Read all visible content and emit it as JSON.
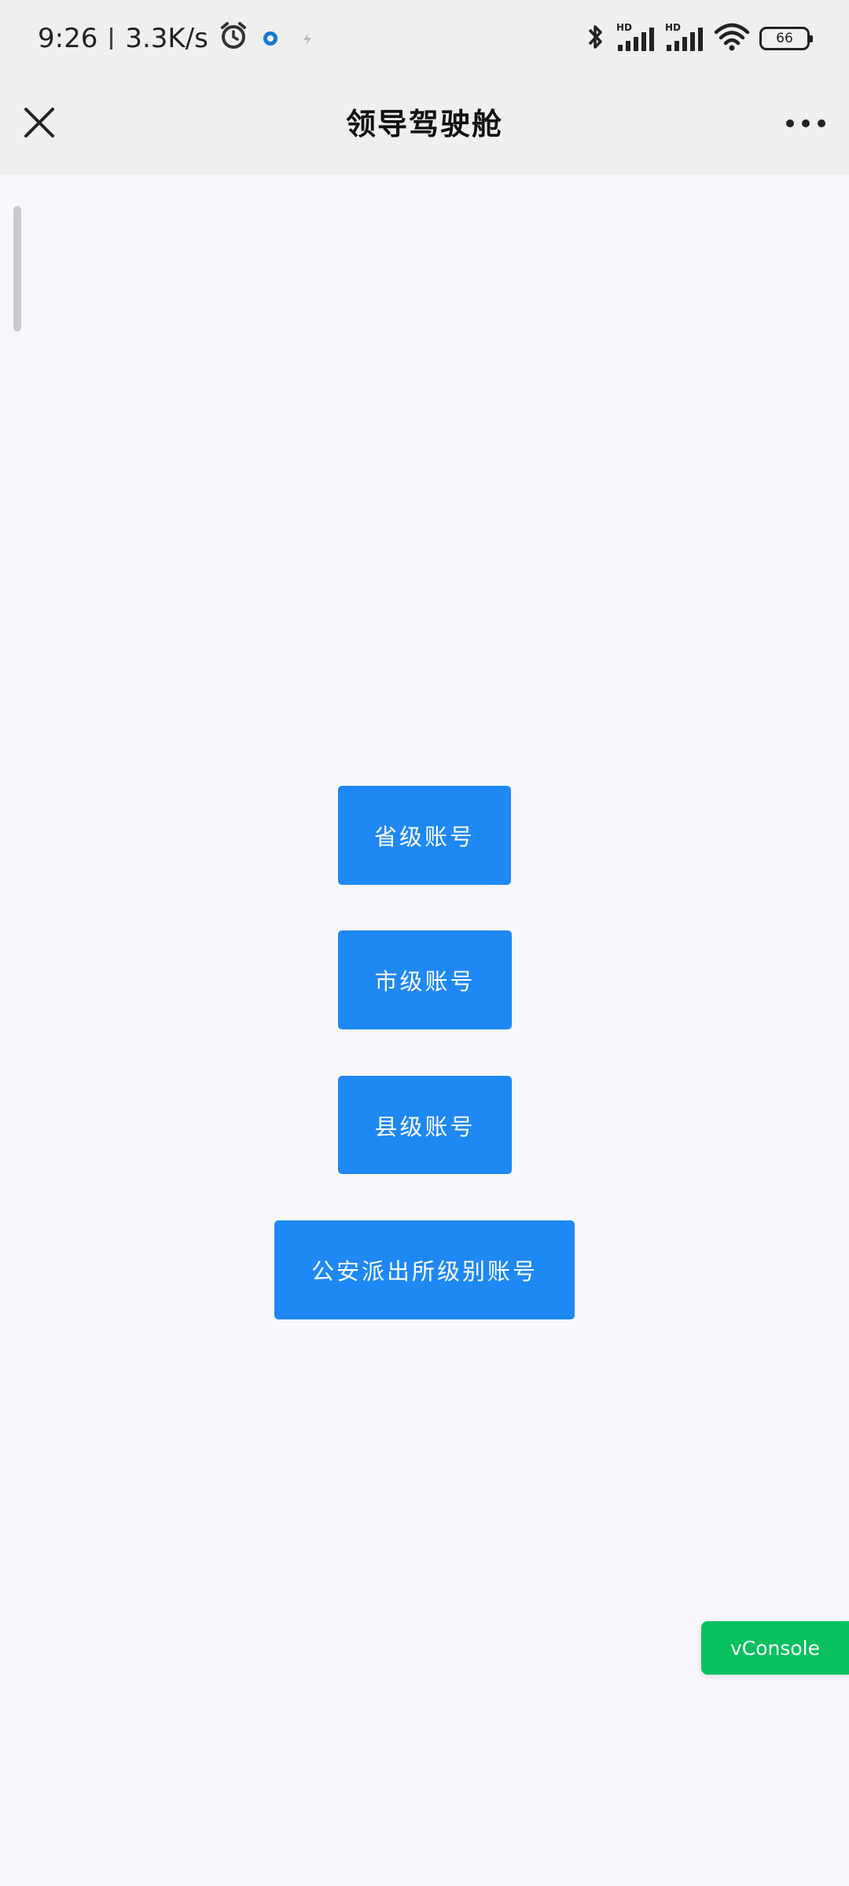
{
  "status_bar": {
    "time": "9:26",
    "net_speed": "3.3K/s",
    "icons": [
      "alarm-icon",
      "app-notification-icon",
      "bolt-icon",
      "bluetooth-icon",
      "hd-signal-icon",
      "hd-signal-icon",
      "wifi-icon"
    ],
    "signal1_label": "HD",
    "signal2_label": "HD",
    "battery_level": "66"
  },
  "header": {
    "title": "领导驾驶舱",
    "close_icon": "close-icon",
    "more_icon": "more-dots-icon"
  },
  "main": {
    "buttons": [
      {
        "label": "省级账号"
      },
      {
        "label": "市级账号"
      },
      {
        "label": "县级账号"
      },
      {
        "label": "公安派出所级别账号"
      }
    ]
  },
  "vconsole": {
    "label": "vConsole",
    "color": "#07c160"
  },
  "colors": {
    "button": "#1e88f5",
    "background": "#f8f7fb",
    "header": "#efefef"
  }
}
